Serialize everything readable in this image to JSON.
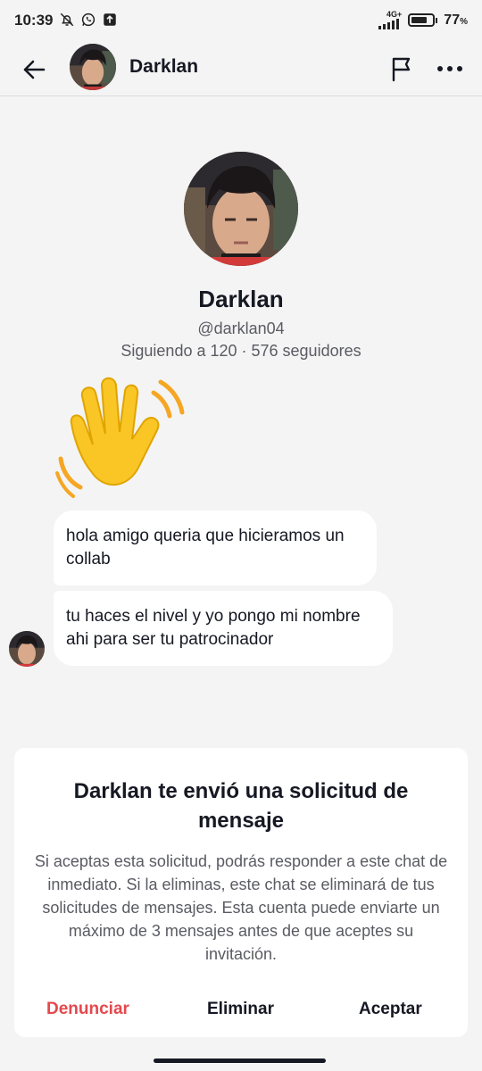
{
  "status_bar": {
    "time": "10:39",
    "network": "4G+",
    "battery_percent": "77",
    "battery_unit": "%",
    "battery_level": 0.77,
    "icons": [
      "mute-bell-icon",
      "whatsapp-icon",
      "upload-icon",
      "signal-icon",
      "battery-icon"
    ]
  },
  "header": {
    "name": "Darklan",
    "icons": [
      "back-arrow-icon",
      "flag-icon",
      "more-dots-icon"
    ]
  },
  "profile": {
    "name": "Darklan",
    "handle": "@darklan04",
    "stats": "Siguiendo a 120 · 576 seguidores"
  },
  "messages": [
    {
      "text": "hola amigo queria que hicieramos un collab"
    },
    {
      "text": "tu haces el nivel y yo pongo mi nombre ahi para ser tu patrocinador"
    }
  ],
  "request_card": {
    "title": "Darklan te envió una solicitud de mensaje",
    "body": "Si aceptas esta solicitud, podrás responder a este chat de inmediato. Si la eliminas, este chat se eliminará de tus solicitudes de mensajes. Esta cuenta puede enviarte un máximo de 3 mensajes antes de que aceptes su invitación.",
    "report_label": "Denunciar",
    "delete_label": "Eliminar",
    "accept_label": "Aceptar"
  },
  "colors": {
    "background": "#f4f4f4",
    "report_red": "#e5484d",
    "text_primary": "#161823",
    "text_secondary": "#5a5b63",
    "wave_yellow": "#f9c625"
  }
}
